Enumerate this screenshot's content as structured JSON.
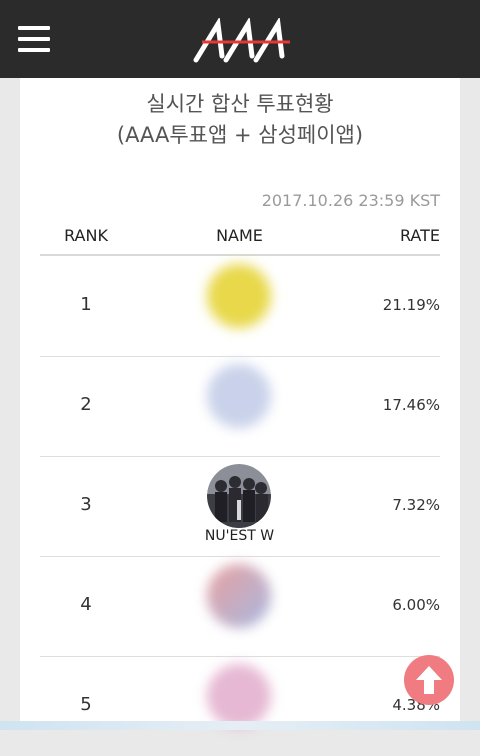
{
  "header": {
    "menu_icon": "hamburger-menu-icon",
    "logo_icon": "aaa-logo-icon",
    "logo_text": "AAA"
  },
  "page": {
    "title_line1": "실시간 합산 투표현황",
    "title_line2": "(AAA투표앱 + 삼성페이앱)",
    "timestamp": "2017.10.26 23:59 KST"
  },
  "table": {
    "headers": {
      "rank": "RANK",
      "name": "NAME",
      "rate": "RATE"
    },
    "rows": [
      {
        "rank": "1",
        "name": "",
        "rate": "21.19%",
        "avatar_color": "#e8d84a"
      },
      {
        "rank": "2",
        "name": "",
        "rate": "17.46%",
        "avatar_color": "#c9d2ea"
      },
      {
        "rank": "3",
        "name": "NU'EST W",
        "rate": "7.32%",
        "avatar_color": "#5a5a66"
      },
      {
        "rank": "4",
        "name": "",
        "rate": "6.00%",
        "avatar_color": "#e8a0a0"
      },
      {
        "rank": "5",
        "name": "",
        "rate": "4.38%",
        "avatar_color": "#e6b8d3"
      }
    ]
  },
  "scroll_top_icon": "arrow-up-icon",
  "colors": {
    "header_bg": "#2b2b2b",
    "accent_red": "#e53935",
    "scroll_button": "#f07b80"
  }
}
